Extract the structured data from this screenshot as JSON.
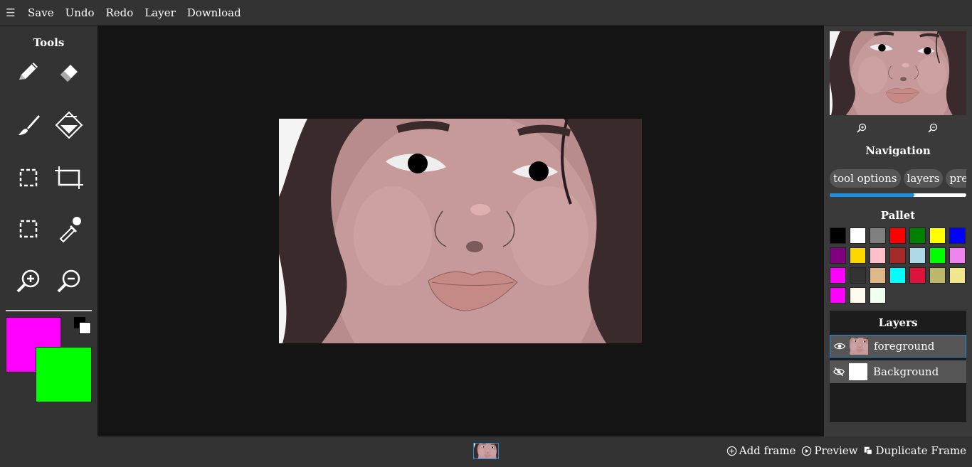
{
  "menu": {
    "icon": "hamburger-icon",
    "items": [
      "Save",
      "Undo",
      "Redo",
      "Layer",
      "Download"
    ]
  },
  "tools": {
    "title": "Tools",
    "items": [
      "pencil-icon",
      "eraser-icon",
      "brush-icon",
      "fill-bucket-icon",
      "rect-select-icon",
      "crop-icon",
      "free-select-icon",
      "eyedropper-icon",
      "zoom-in-icon",
      "zoom-out-icon"
    ],
    "primary_color": "#ff00ff",
    "secondary_color": "#00ff00"
  },
  "side": {
    "navigation_title": "Navigation",
    "tabs": [
      "tool options",
      "layers",
      "preview"
    ],
    "pallet_title": "Pallet",
    "palette": [
      "#000000",
      "#ffffff",
      "#808080",
      "#ff0000",
      "#008000",
      "#ffff00",
      "#0000ff",
      "#800080",
      "#ffd700",
      "#ffc0cb",
      "#a52a2a",
      "#add8e6",
      "#00ff00",
      "#ee82ee",
      "#ff00ff",
      "#333333",
      "#deb887",
      "#00ffff",
      "#dc143c",
      "#bdb76b",
      "#f0e68c",
      "#ff00ff",
      "#fffaf0",
      "#f0fff0"
    ],
    "layers_title": "Layers",
    "layers": [
      {
        "name": "foreground",
        "visible": true,
        "active": true
      },
      {
        "name": "Background",
        "visible": false,
        "active": false
      }
    ]
  },
  "bottom": {
    "add_frame": "Add frame",
    "preview": "Preview",
    "duplicate_frame": "Duplicate Frame"
  },
  "colors": {
    "accent": "#1d8fe0"
  }
}
